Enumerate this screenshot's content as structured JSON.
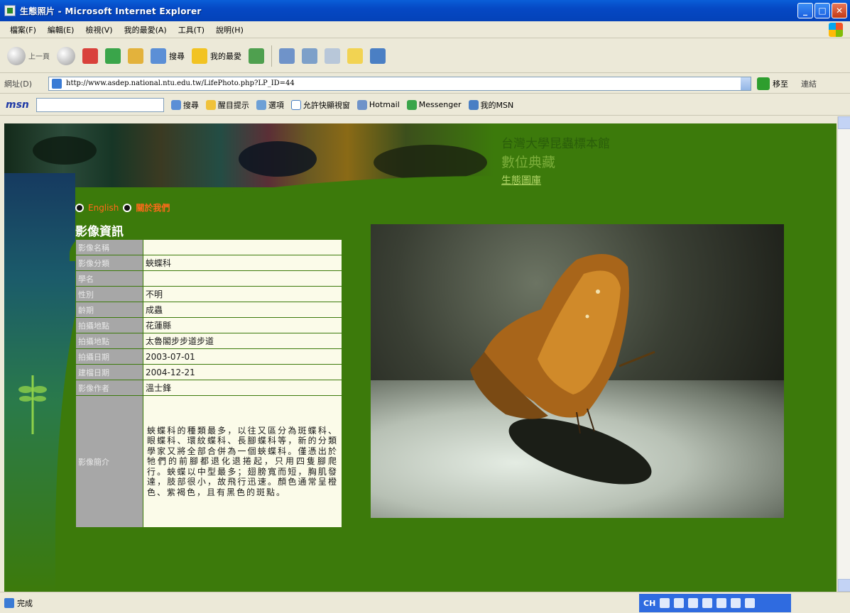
{
  "window": {
    "title": "生態照片 - Microsoft Internet Explorer"
  },
  "menu": [
    "檔案(F)",
    "編輯(E)",
    "檢視(V)",
    "我的最愛(A)",
    "工具(T)",
    "說明(H)"
  ],
  "toolbar": {
    "back_label": "上一頁",
    "search_label": "搜尋",
    "favorites_label": "我的最愛"
  },
  "address": {
    "label": "網址(D)",
    "url": "http://www.asdep.national.ntu.edu.tw/LifePhoto.php?LP_ID=44",
    "go_label": "移至",
    "links_label": "連結"
  },
  "msnbar": {
    "logo": "msn",
    "search_label": "搜尋",
    "highlight_label": "醒目提示",
    "options_label": "選項",
    "popup_label": "允許快顯視窗",
    "hotmail_label": "Hotmail",
    "messenger_label": "Messenger",
    "mymsn_label": "我的MSN"
  },
  "site": {
    "title": "台灣大學昆蟲標本館",
    "subtitle": "數位典藏",
    "subtitle2": "生態圖庫",
    "nav": [
      "English",
      "關於我們"
    ]
  },
  "info": {
    "heading": "影像資訊",
    "rows": [
      {
        "label": "影像名稱",
        "value": ""
      },
      {
        "label": "影像分類",
        "value": "蛺蝶科"
      },
      {
        "label": "學名",
        "value": ""
      },
      {
        "label": "性別",
        "value": "不明"
      },
      {
        "label": "齡期",
        "value": "成蟲"
      },
      {
        "label": "拍攝地點",
        "value": "花蓮縣"
      },
      {
        "label": "拍攝地點",
        "value": "太魯閣步步道步道"
      },
      {
        "label": "拍攝日期",
        "value": "2003-07-01"
      },
      {
        "label": "建檔日期",
        "value": "2004-12-21"
      },
      {
        "label": "影像作者",
        "value": "溫士鋒"
      }
    ],
    "desc_label": "影像簡介",
    "desc_value": "蛺蝶科的種類最多，以往又區分為斑蝶科、眼蝶科、環紋蝶科、長腳蝶科等，新的分類學家又將全部合併為一個蛺蝶科。僅憑出於牠們的前腳都退化退捲起，只用四隻腳爬行。蛺蝶以中型最多；翅膀寬而短，胸肌發達，肢部很小，故飛行迅速。顏色通常呈橙色、紫褐色，且有黑色的斑點。"
  },
  "status": {
    "text": "完成",
    "tray": "CH"
  }
}
